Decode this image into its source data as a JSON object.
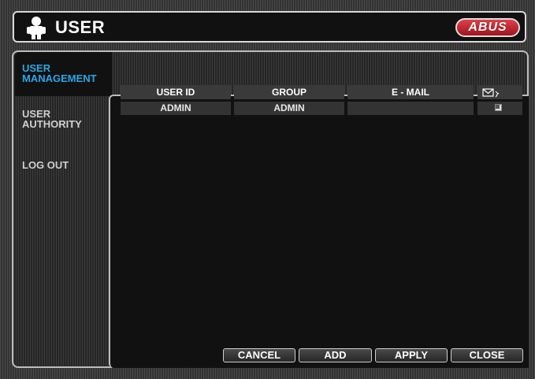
{
  "window": {
    "title": "USER",
    "brand": "ABUS",
    "brand_color": "#c41e26"
  },
  "sidebar": {
    "items": [
      {
        "label_line1": "USER",
        "label_line2": "MANAGEMENT",
        "active": true
      },
      {
        "label_line1": "USER",
        "label_line2": "AUTHORITY",
        "active": false
      },
      {
        "label_line1": "LOG OUT",
        "label_line2": "",
        "active": false
      }
    ]
  },
  "table": {
    "headers": [
      "USER ID",
      "GROUP",
      "E - MAIL"
    ],
    "rows": [
      {
        "user_id": "ADMIN",
        "group": "ADMIN",
        "email": ""
      }
    ],
    "email_column_icon": "mail-icon"
  },
  "buttons": {
    "cancel": "CANCEL",
    "add": "ADD",
    "apply": "APPLY",
    "close": "CLOSE"
  },
  "colors": {
    "accent": "#2aa6e8"
  }
}
